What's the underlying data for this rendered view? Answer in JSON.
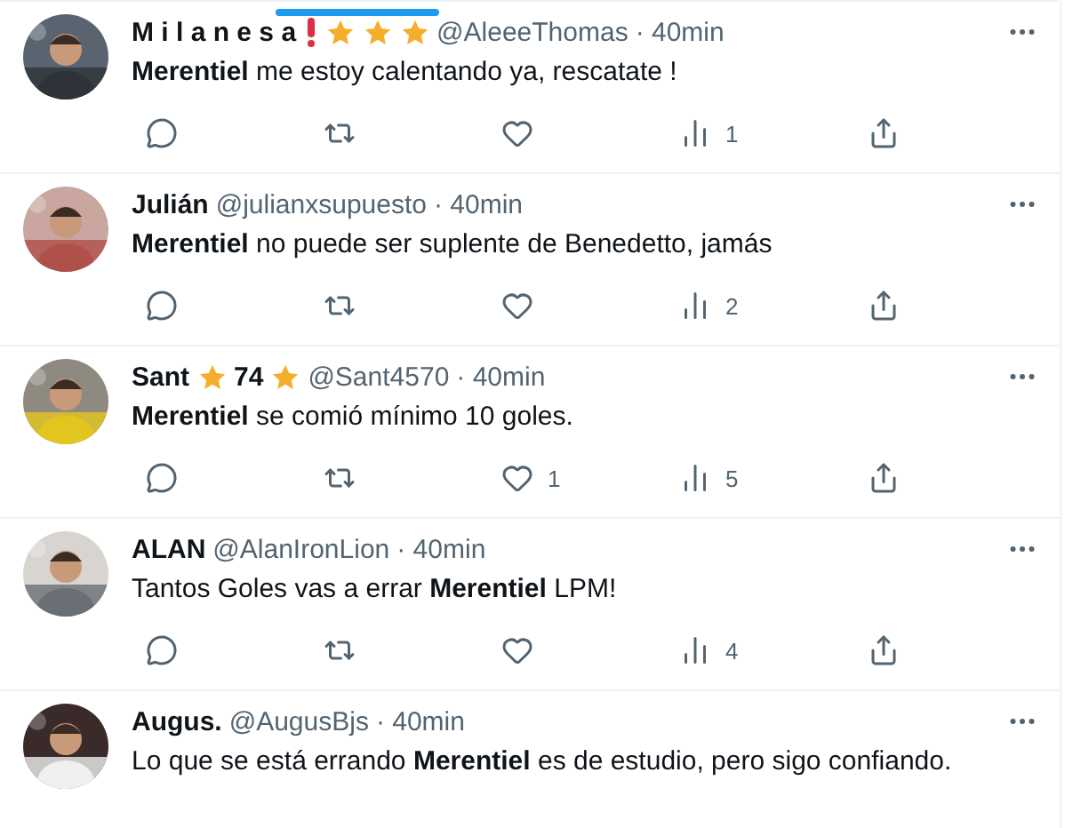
{
  "tweets": [
    {
      "avatar": {
        "kind": "picture"
      },
      "name_parts": [
        {
          "kind": "text",
          "text": "M i l a n e s a"
        },
        {
          "kind": "exclaim"
        },
        {
          "kind": "star"
        },
        {
          "kind": "star"
        },
        {
          "kind": "star"
        }
      ],
      "handle": "@AleeeThomas",
      "time": "· 40min",
      "body": "**Merentiel** me estoy calentando ya, rescatate !",
      "actions": {
        "views": "1"
      }
    },
    {
      "avatar": {
        "kind": "picture"
      },
      "name_parts": [
        {
          "kind": "text",
          "text": "Julián"
        }
      ],
      "handle": "@julianxsupuesto",
      "time": "· 40min",
      "body": "**Merentiel** no puede ser suplente de Benedetto, jamás",
      "actions": {
        "views": "2"
      }
    },
    {
      "avatar": {
        "kind": "picture"
      },
      "name_parts": [
        {
          "kind": "text",
          "text": "Sant"
        },
        {
          "kind": "star"
        },
        {
          "kind": "text",
          "text": "74"
        },
        {
          "kind": "star"
        }
      ],
      "handle": "@Sant4570",
      "time": "· 40min",
      "body": "**Merentiel** se comió mínimo 10 goles.",
      "actions": {
        "likes": "1",
        "views": "5"
      }
    },
    {
      "avatar": {
        "kind": "picture"
      },
      "name_parts": [
        {
          "kind": "text",
          "text": "ALAN"
        }
      ],
      "handle": "@AlanIronLion",
      "time": "· 40min",
      "body": "Tantos Goles vas a errar **Merentiel** LPM!",
      "actions": {
        "views": "4"
      }
    },
    {
      "avatar": {
        "kind": "picture"
      },
      "name_parts": [
        {
          "kind": "text",
          "text": "Augus."
        }
      ],
      "handle": "@AugusBjs",
      "time": "· 40min",
      "body": "Lo que se está errando **Merentiel** es de estudio, pero sigo confiando."
    }
  ]
}
